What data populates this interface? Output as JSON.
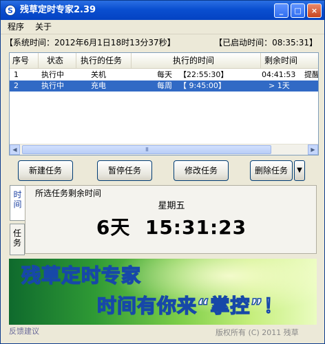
{
  "window": {
    "title": "残草定时专家2.39",
    "app_icon_glyph": "S",
    "buttons": {
      "minimize": "_",
      "maximize": "□",
      "close": "×"
    }
  },
  "menu": {
    "items": [
      "程序",
      "关于"
    ]
  },
  "status": {
    "system_time": "【系统时间：2012年6月1日18时13分37秒】",
    "uptime": "【已启动时间：08:35:31】"
  },
  "table": {
    "headers": [
      "序号",
      "状态",
      "执行的任务",
      "执行的时间",
      "剩余时间"
    ],
    "rows": [
      {
        "index": "1",
        "status": "执行中",
        "task": "关机",
        "period": "每天",
        "time": "【22:55:30】",
        "remaining": "04:41:53",
        "extra": "提醒"
      },
      {
        "index": "2",
        "status": "执行中",
        "task": "充电",
        "period": "每周",
        "time": "【 9:45:00】",
        "remaining": "> 1天",
        "extra": ""
      }
    ],
    "selected_row": 1,
    "scroll_glyphs": {
      "left": "◀",
      "right": "▶",
      "thumb": "III"
    }
  },
  "buttons": {
    "new_task": "新建任务",
    "pause_task": "暂停任务",
    "edit_task": "修改任务",
    "delete_task": "删除任务",
    "dropdown": "▼"
  },
  "tabs": {
    "time": "时间",
    "task": "任务"
  },
  "panel": {
    "title": "所选任务剩余时间",
    "weekday": "星期五",
    "countdown": "6天  15:31:23"
  },
  "banner": {
    "title": "残草定时专家",
    "slogan": "时间有你来“掌控”！"
  },
  "footer": {
    "copyright": "版权所有 (C) 2011 残草",
    "link_text": "反馈建议"
  },
  "colors": {
    "titlebar": "#0a4fd0",
    "selection": "#316ac5",
    "tab_active_text": "#1a3fa0",
    "banner_text_stroke": "#1748a8"
  }
}
